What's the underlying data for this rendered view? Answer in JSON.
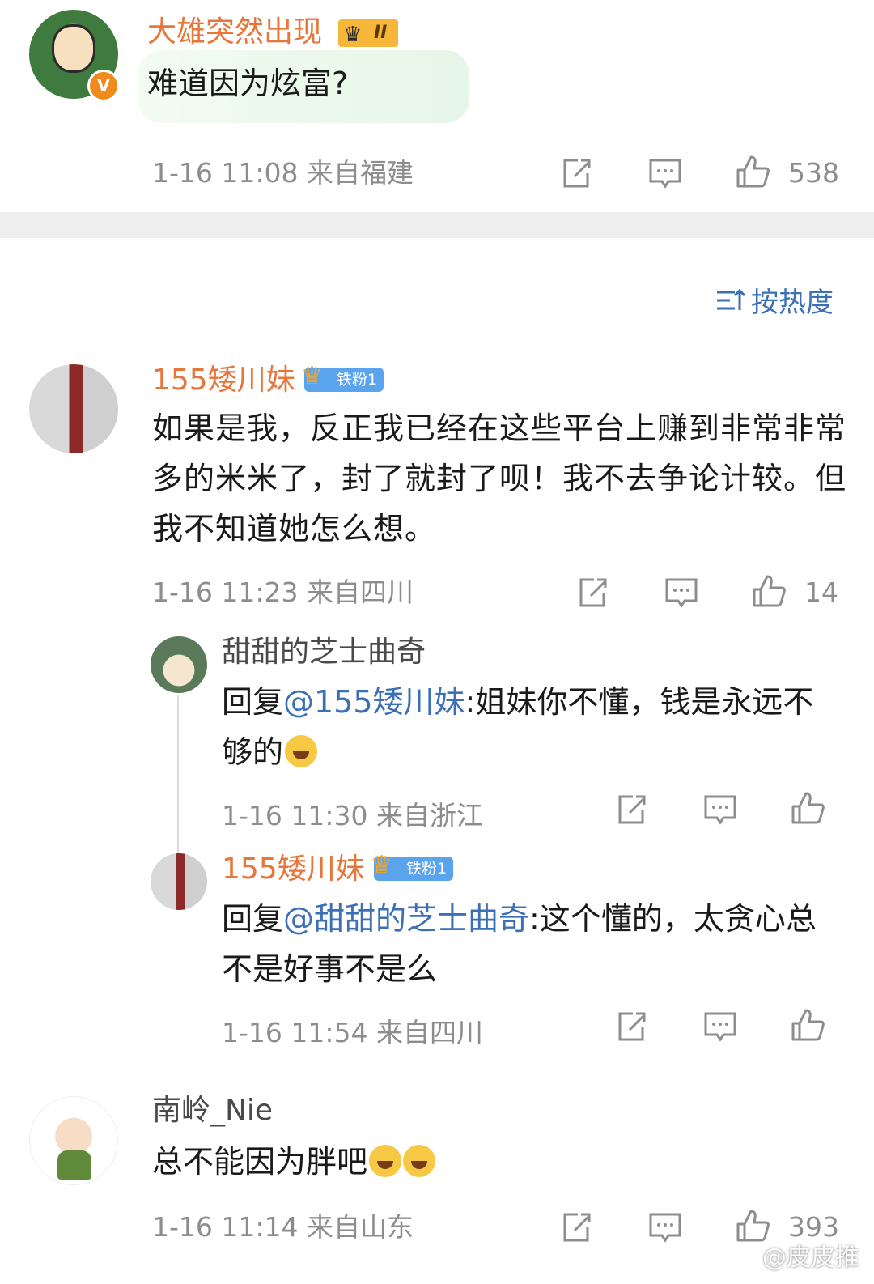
{
  "top_comment": {
    "username": "大雄突然出现",
    "vip_level": "II",
    "text": "难道因为炫富?",
    "meta": "1-16 11:08 来自福建",
    "likes": "538"
  },
  "sort": {
    "label": "按热度"
  },
  "comments": [
    {
      "username": "155矮川妹",
      "fan_badge": "铁粉1",
      "text": "如果是我，反正我已经在这些平台上赚到非常非常多的米米了，封了就封了呗！我不去争论计较。但我不知道她怎么想。",
      "meta": "1-16 11:23 来自四川",
      "likes": "14",
      "replies": [
        {
          "username": "甜甜的芝士曲奇",
          "reply_prefix": "回复",
          "mention": "@155矮川妹",
          "text": ":姐妹你不懂，钱是永远不够的",
          "meta": "1-16 11:30 来自浙江"
        },
        {
          "username": "155矮川妹",
          "fan_badge": "铁粉1",
          "reply_prefix": "回复",
          "mention": "@甜甜的芝士曲奇",
          "text": ":这个懂的，太贪心总不是好事不是么",
          "meta": "1-16 11:54 来自四川"
        }
      ]
    },
    {
      "username": "南岭_Nie",
      "text": "总不能因为胖吧",
      "meta": "1-16 11:14 来自山东",
      "likes": "393"
    }
  ],
  "watermark": "@皮皮推",
  "colors": {
    "username_orange": "#e8763a",
    "link_blue": "#3b6fb6",
    "meta_gray": "#8d8d8d",
    "divider": "#eeeeee"
  },
  "icons": [
    "share-icon",
    "comment-icon",
    "like-icon",
    "sort-icon",
    "verified-icon",
    "laugh-cry-emoji"
  ]
}
